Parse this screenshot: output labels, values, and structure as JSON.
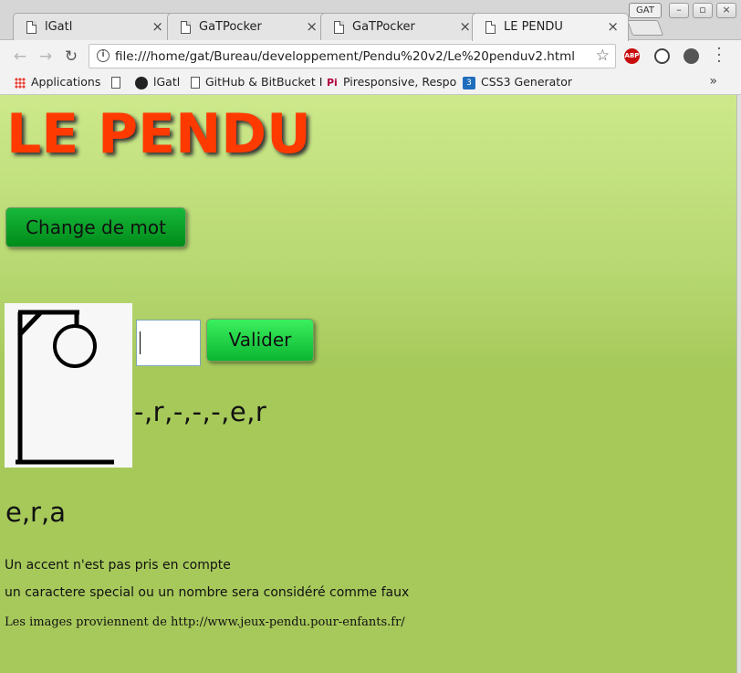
{
  "browser": {
    "tabs": [
      {
        "label": "lGatl",
        "active": false
      },
      {
        "label": "GaTPocker",
        "active": false
      },
      {
        "label": "GaTPocker",
        "active": false
      },
      {
        "label": "LE PENDU",
        "active": true
      }
    ],
    "profile_label": "GAT",
    "address": "file:///home/gat/Bureau/developpement/Pendu%20v2/Le%20penduv2.html",
    "bookmarks": [
      {
        "label": "Applications",
        "icon": "apps-grid-icon"
      },
      {
        "label": "",
        "icon": "page-icon"
      },
      {
        "label": "lGatl",
        "icon": "github-icon"
      },
      {
        "label": "GitHub & BitBucket I",
        "icon": "page-icon"
      },
      {
        "label": "Piresponsive, Respo",
        "icon": "pi-icon"
      },
      {
        "label": "CSS3 Generator",
        "icon": "css3-icon"
      }
    ],
    "extensions": [
      "abp-icon",
      "sync-icon",
      "extension-icon"
    ]
  },
  "page": {
    "title": "LE PENDU",
    "change_word_button": "Change de mot",
    "letter_input_value": "",
    "validate_button": "Valider",
    "masked_word": "-,r,-,-,-,e,r",
    "tried_letters": "e,r,a",
    "notes": [
      "Un accent n'est pas pris en compte",
      "un caractere special ou un nombre sera considéré comme faux"
    ],
    "credit": "Les images proviennent de http://www.jeux-pendu.pour-enfants.fr/"
  },
  "colors": {
    "title": "#ff3a00",
    "change_button": "#0a9f2a",
    "validate_button": "#22dc48",
    "page_background": "#a7c95b"
  }
}
